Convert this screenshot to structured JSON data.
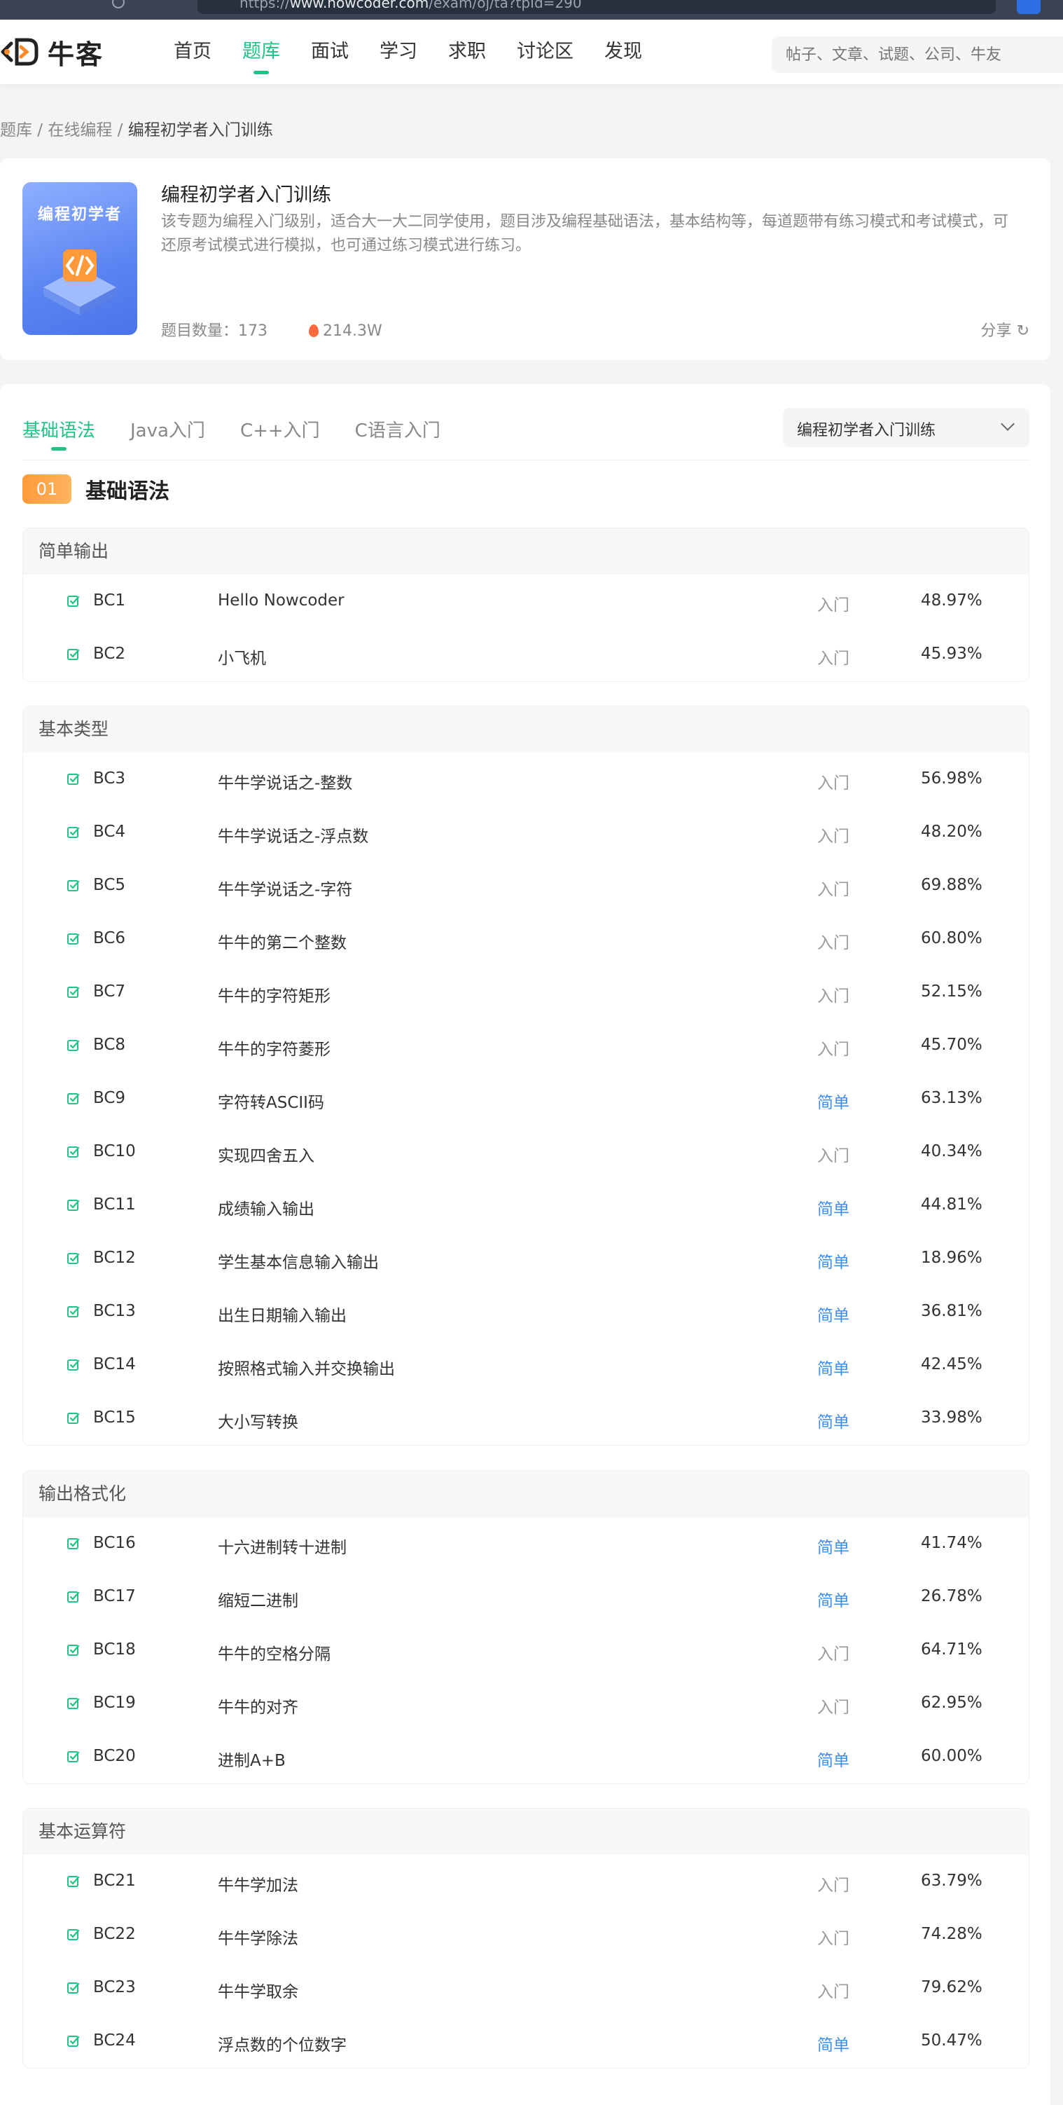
{
  "browser": {
    "url_prefix": "https://",
    "url_host": "www.nowcoder.com",
    "url_path": "/exam/oj/ta?tpId=290"
  },
  "header": {
    "logo_text": "牛客",
    "nav": [
      {
        "label": "首页"
      },
      {
        "label": "题库"
      },
      {
        "label": "面试"
      },
      {
        "label": "学习"
      },
      {
        "label": "求职"
      },
      {
        "label": "讨论区"
      },
      {
        "label": "发现"
      }
    ],
    "active_nav": "题库",
    "search_placeholder": "帖子、文章、试题、公司、牛友"
  },
  "breadcrumb": {
    "item1": "题库",
    "item2": "在线编程",
    "current": "编程初学者入门训练",
    "sep": " / "
  },
  "intro": {
    "cover_title": "编程初学者",
    "title": "编程初学者入门训练",
    "desc": "该专题为编程入门级别，适合大一大二同学使用，题目涉及编程基础语法，基本结构等，每道题带有练习模式和考试模式，可还原考试模式进行模拟，也可通过练习模式进行练习。",
    "count_label": "题目数量：173",
    "hot": "214.3W",
    "share": "分享"
  },
  "tabs": [
    {
      "label": "基础语法"
    },
    {
      "label": "Java入门"
    },
    {
      "label": "C++入门"
    },
    {
      "label": "C语言入门"
    }
  ],
  "active_tab": "基础语法",
  "select_value": "编程初学者入门训练",
  "section": {
    "badge": "01",
    "title": "基础语法"
  },
  "groups": [
    {
      "title": "简单输出",
      "rows": [
        {
          "id": "BC1",
          "title": "Hello Nowcoder",
          "level": "入门",
          "rate": "48.97%"
        },
        {
          "id": "BC2",
          "title": "小飞机",
          "level": "入门",
          "rate": "45.93%"
        }
      ]
    },
    {
      "title": "基本类型",
      "rows": [
        {
          "id": "BC3",
          "title": "牛牛学说话之-整数",
          "level": "入门",
          "rate": "56.98%"
        },
        {
          "id": "BC4",
          "title": "牛牛学说话之-浮点数",
          "level": "入门",
          "rate": "48.20%"
        },
        {
          "id": "BC5",
          "title": "牛牛学说话之-字符",
          "level": "入门",
          "rate": "69.88%"
        },
        {
          "id": "BC6",
          "title": "牛牛的第二个整数",
          "level": "入门",
          "rate": "60.80%"
        },
        {
          "id": "BC7",
          "title": "牛牛的字符矩形",
          "level": "入门",
          "rate": "52.15%"
        },
        {
          "id": "BC8",
          "title": "牛牛的字符菱形",
          "level": "入门",
          "rate": "45.70%"
        },
        {
          "id": "BC9",
          "title": "字符转ASCII码",
          "level": "简单",
          "rate": "63.13%"
        },
        {
          "id": "BC10",
          "title": "实现四舍五入",
          "level": "入门",
          "rate": "40.34%"
        },
        {
          "id": "BC11",
          "title": "成绩输入输出",
          "level": "简单",
          "rate": "44.81%"
        },
        {
          "id": "BC12",
          "title": "学生基本信息输入输出",
          "level": "简单",
          "rate": "18.96%"
        },
        {
          "id": "BC13",
          "title": "出生日期输入输出",
          "level": "简单",
          "rate": "36.81%"
        },
        {
          "id": "BC14",
          "title": "按照格式输入并交换输出",
          "level": "简单",
          "rate": "42.45%"
        },
        {
          "id": "BC15",
          "title": "大小写转换",
          "level": "简单",
          "rate": "33.98%"
        }
      ]
    },
    {
      "title": "输出格式化",
      "rows": [
        {
          "id": "BC16",
          "title": "十六进制转十进制",
          "level": "简单",
          "rate": "41.74%"
        },
        {
          "id": "BC17",
          "title": "缩短二进制",
          "level": "简单",
          "rate": "26.78%"
        },
        {
          "id": "BC18",
          "title": "牛牛的空格分隔",
          "level": "入门",
          "rate": "64.71%"
        },
        {
          "id": "BC19",
          "title": "牛牛的对齐",
          "level": "入门",
          "rate": "62.95%"
        },
        {
          "id": "BC20",
          "title": "进制A+B",
          "level": "简单",
          "rate": "60.00%"
        }
      ]
    },
    {
      "title": "基本运算符",
      "rows": [
        {
          "id": "BC21",
          "title": "牛牛学加法",
          "level": "入门",
          "rate": "63.79%"
        },
        {
          "id": "BC22",
          "title": "牛牛学除法",
          "level": "入门",
          "rate": "74.28%"
        },
        {
          "id": "BC23",
          "title": "牛牛学取余",
          "level": "入门",
          "rate": "79.62%"
        },
        {
          "id": "BC24",
          "title": "浮点数的个位数字",
          "level": "简单",
          "rate": "50.47%"
        }
      ]
    }
  ],
  "colors": {
    "accent": "#20c384",
    "easy": "#3b8ff5",
    "badge": "#ff9a3a"
  }
}
